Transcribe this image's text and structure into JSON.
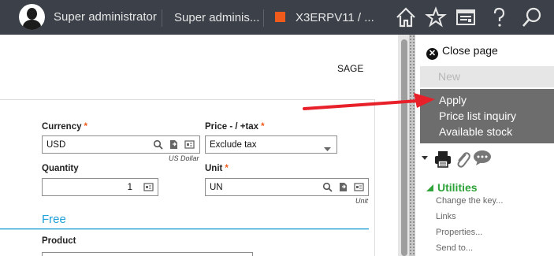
{
  "topbar": {
    "user_name": "Super administrator",
    "role": "Super adminis...",
    "folder": "X3ERPV11 / ...",
    "folder_color": "#f05a1a",
    "icons": [
      "home-icon",
      "star-icon",
      "screen-icon",
      "help-icon",
      "search-icon"
    ]
  },
  "form": {
    "company_code": "SAGE",
    "currency": {
      "label": "Currency",
      "value": "USD",
      "hint": "US Dollar"
    },
    "price_tax": {
      "label": "Price - / +tax",
      "value": "Exclude tax"
    },
    "quantity": {
      "label": "Quantity",
      "value": "1"
    },
    "unit": {
      "label": "Unit",
      "value": "UN",
      "hint": "Unit"
    },
    "section_free": "Free",
    "product": {
      "label": "Product",
      "value": ""
    },
    "required_marker": "*"
  },
  "panel": {
    "close_page": "Close page",
    "new_label": "New",
    "actions": [
      "Apply",
      "Price list inquiry",
      "Available stock"
    ],
    "tool_icons": [
      "print-icon",
      "attachment-icon",
      "comment-icon"
    ],
    "utilities": {
      "title": "Utilities",
      "items": [
        "Change the key...",
        "Links",
        "Properties...",
        "Send to..."
      ]
    }
  },
  "colors": {
    "topbar_bg": "#3b4049",
    "accent_blue": "#1e9fd8",
    "required_orange": "#f05a1a",
    "utilities_green": "#2da339",
    "menu_bg": "#6d6d6d",
    "arrow_red": "#e8202a"
  }
}
